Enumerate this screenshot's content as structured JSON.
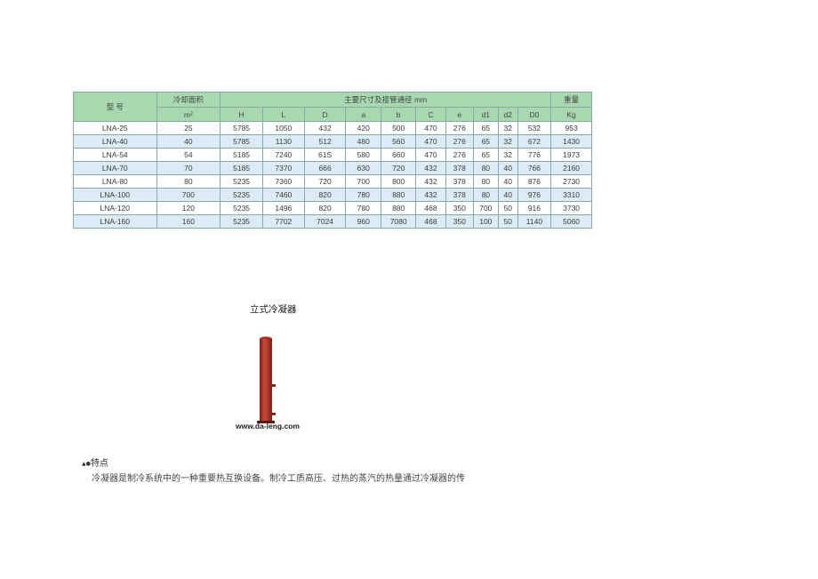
{
  "table": {
    "header": {
      "model": "型 号",
      "area": "冷却面积",
      "area_unit": "m²",
      "dims_group": "主要尺寸及接管通径 mm",
      "weight": "重量",
      "weight_unit": "Kg",
      "dim_columns": [
        "H",
        "L",
        "D",
        "a",
        "b",
        "C",
        "e",
        "d1",
        "d2",
        "D0"
      ]
    },
    "rows": [
      [
        "LNA-25",
        "25",
        "5785",
        "1050",
        "432",
        "420",
        "500",
        "470",
        "276",
        "65",
        "32",
        "532",
        "953"
      ],
      [
        "LNA-40",
        "40",
        "5785",
        "1130",
        "512",
        "480",
        "560",
        "470",
        "276",
        "65",
        "32",
        "672",
        "1430"
      ],
      [
        "LNA-54",
        "54",
        "5185",
        "7240",
        "61S",
        "580",
        "660",
        "470",
        "276",
        "65",
        "32",
        "776",
        "1973"
      ],
      [
        "LNA-70",
        "70",
        "5185",
        "7370",
        "666",
        "630",
        "720",
        "432",
        "378",
        "80",
        "40",
        "766",
        "2160"
      ],
      [
        "LNA-80",
        "80",
        "5235",
        "7360",
        "720",
        "700",
        "800",
        "432",
        "378",
        "80",
        "40",
        "876",
        "2730"
      ],
      [
        "LNA-100",
        "700",
        "5235",
        "7460",
        "820",
        "780",
        "880",
        "432",
        "378",
        "80",
        "40",
        "976",
        "3310"
      ],
      [
        "LNA-120",
        "120",
        "5235",
        "1496",
        "820",
        "780",
        "880",
        "468",
        "350",
        "700",
        "50",
        "916",
        "3730"
      ],
      [
        "LNA-160",
        "160",
        "5235",
        "7702",
        "7024",
        "960",
        "7080",
        "468",
        "350",
        "100",
        "50",
        "1140",
        "5060"
      ]
    ]
  },
  "figure": {
    "caption": "立式冷凝器",
    "url": "www.da-leng.com"
  },
  "features": {
    "bullets": "▲●",
    "title": "特点",
    "text": "冷凝器是制冷系统中的一种重要热互换设备。制冷工质高压、过热的蒸汽的热量通过冷凝器的传"
  },
  "colors": {
    "header_bg": "#a8d8b0",
    "row_alt_bg": "#dcecf6",
    "condenser_red": "#b83a2c"
  }
}
